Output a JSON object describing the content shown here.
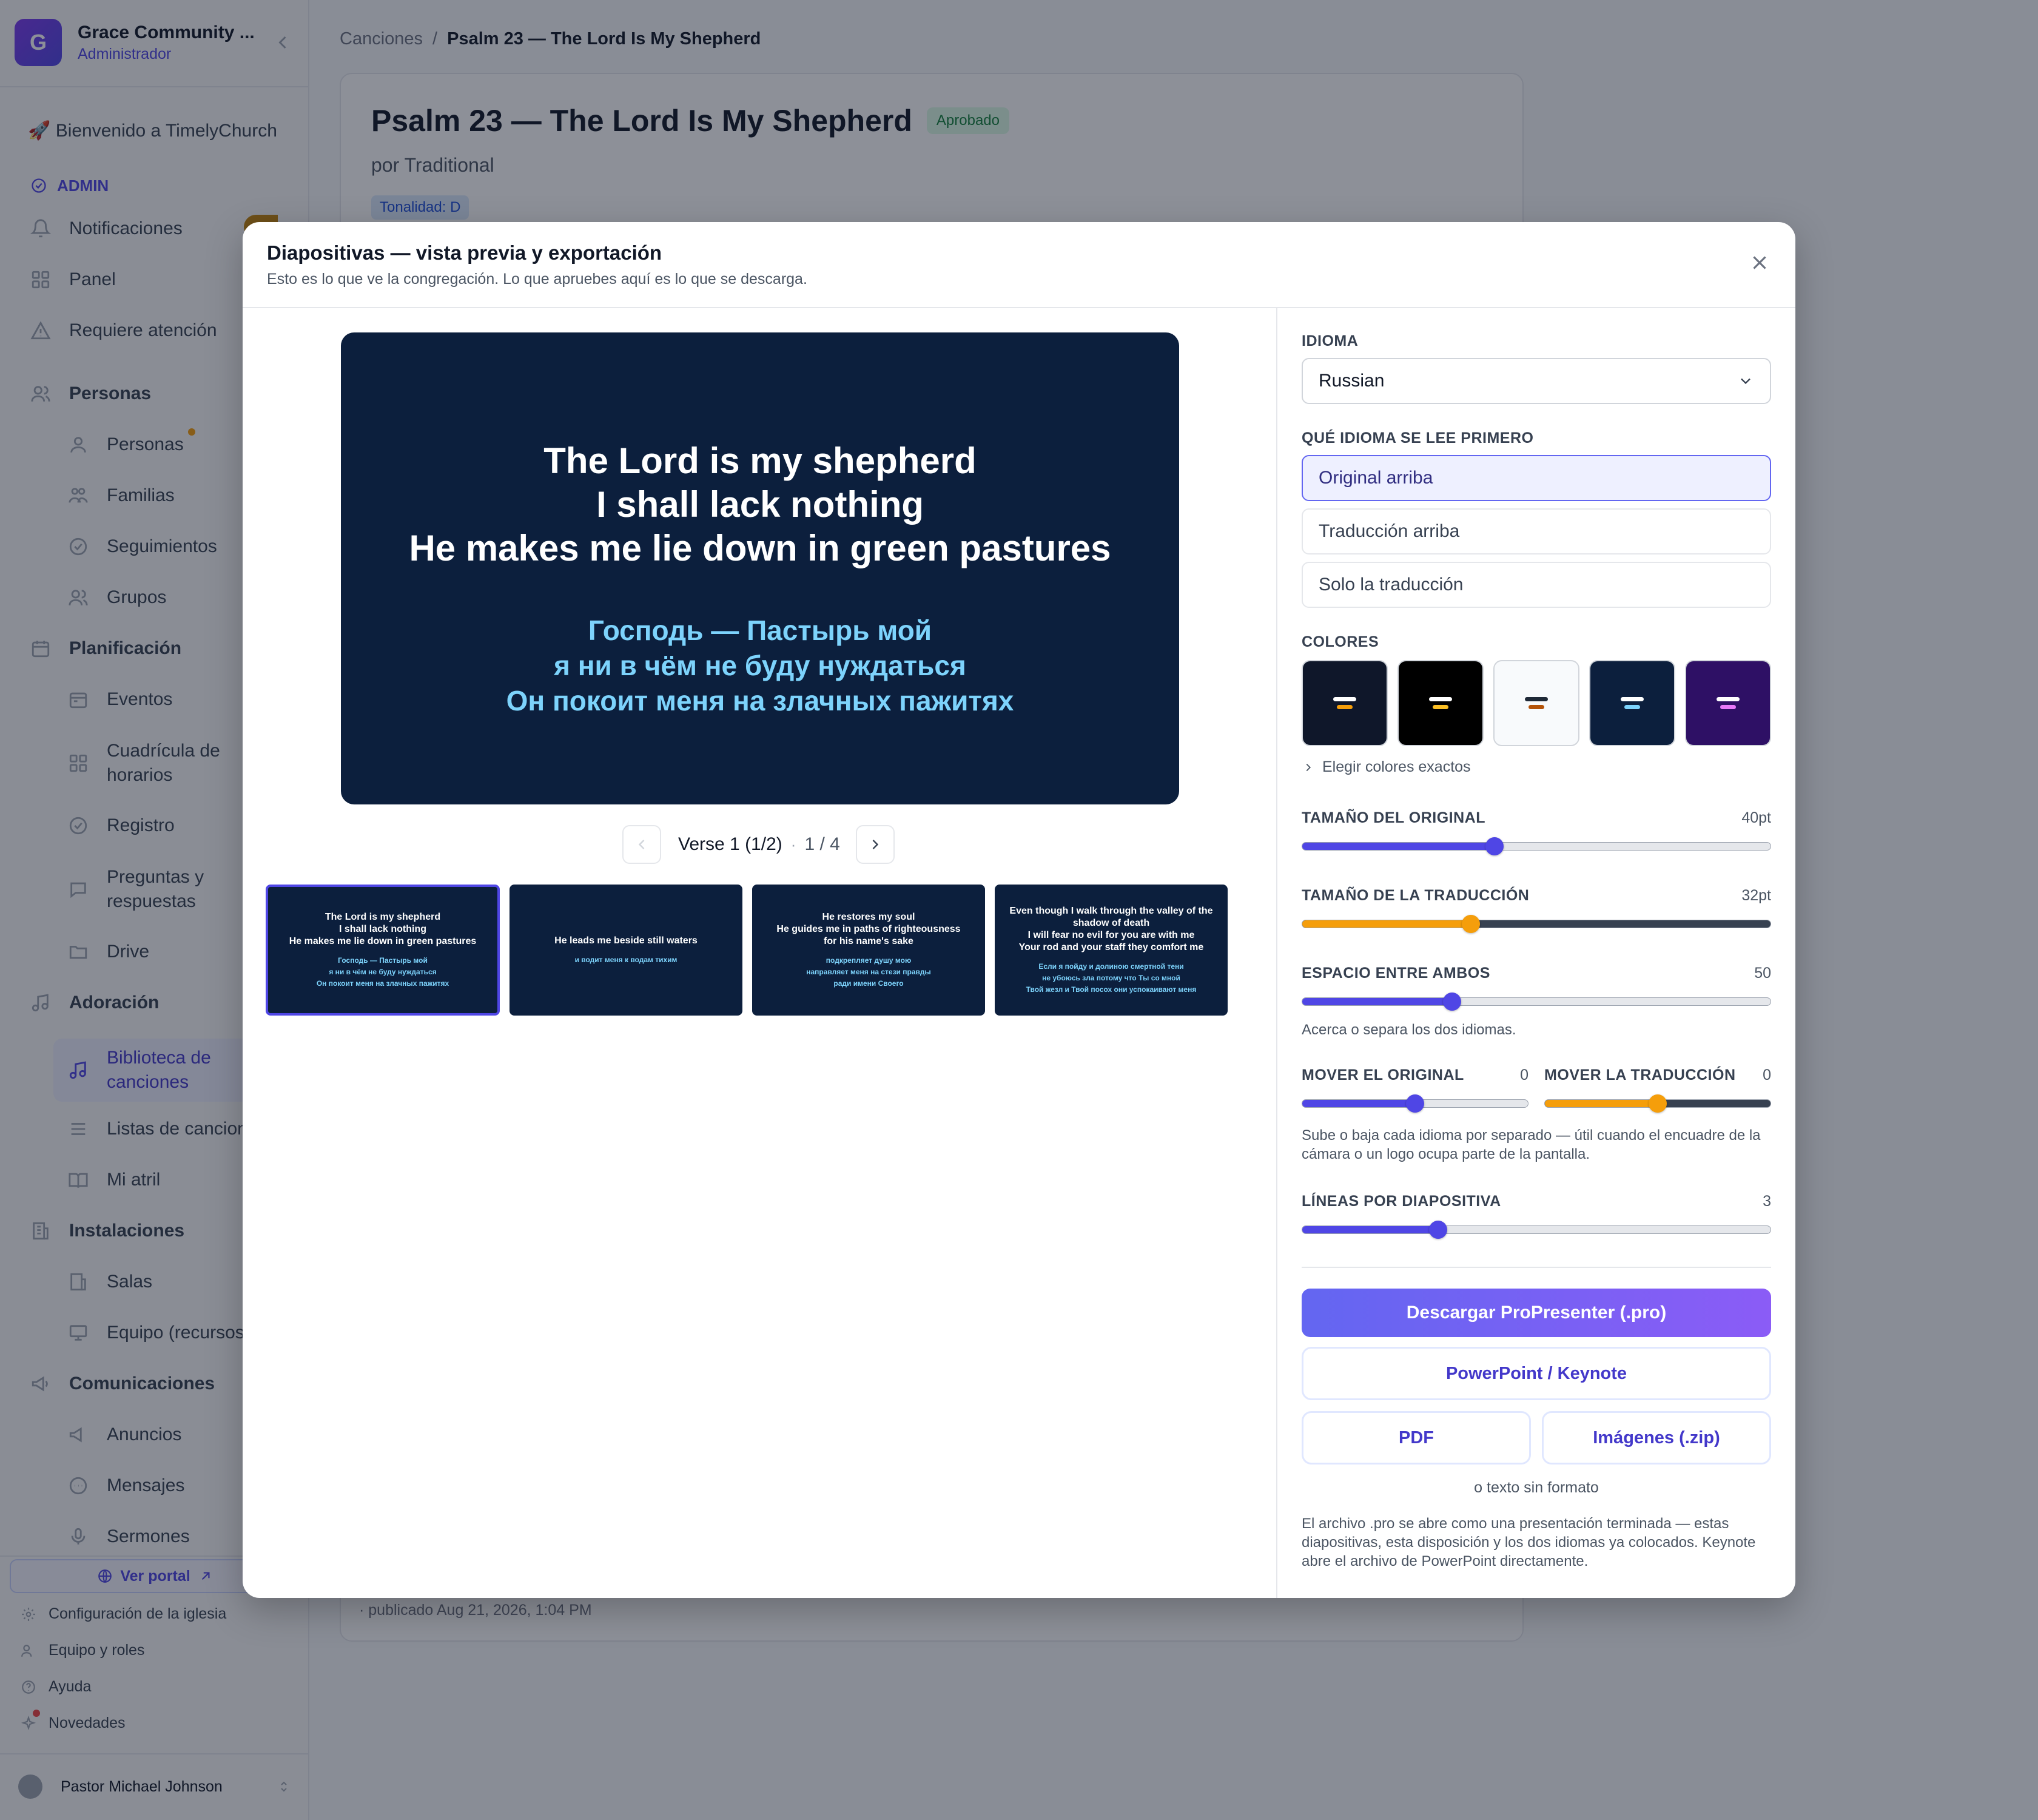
{
  "org": {
    "initial": "G",
    "name": "Grace Community ...",
    "role": "Administrador"
  },
  "sidebar": {
    "welcome": "🚀 Bienvenido a TimelyChurch",
    "admin_label": "ADMIN",
    "items": {
      "notificaciones": "Notificaciones",
      "panel": "Panel",
      "requiere": "Requiere atención",
      "personas_section": "Personas",
      "personas": "Personas",
      "familias": "Familias",
      "seguimientos": "Seguimientos",
      "grupos": "Grupos",
      "planificacion_section": "Planificación",
      "eventos": "Eventos",
      "cuadricula_1": "Cuadrícula de",
      "cuadricula_2": "horarios",
      "registro": "Registro",
      "preguntas_1": "Preguntas y",
      "preguntas_2": "respuestas",
      "drive": "Drive",
      "adoracion_section": "Adoración",
      "biblioteca_1": "Biblioteca de",
      "biblioteca_2": "canciones",
      "listas": "Listas de canciones",
      "atril": "Mi atril",
      "instalaciones_section": "Instalaciones",
      "salas": "Salas",
      "equipo": "Equipo (recursos)",
      "comunicaciones_section": "Comunicaciones",
      "anuncios": "Anuncios",
      "mensajes": "Mensajes",
      "sermones": "Sermones"
    },
    "portal": "Ver portal",
    "footer": {
      "config": "Configuración de la iglesia",
      "team": "Equipo y roles",
      "help": "Ayuda",
      "news": "Novedades"
    },
    "user": "Pastor Michael Johnson"
  },
  "breadcrumb": {
    "parent": "Canciones",
    "current": "Psalm 23 — The Lord Is My Shepherd"
  },
  "song": {
    "title": "Psalm 23 — The Lord Is My Shepherd",
    "status": "Aprobado",
    "author": "por Traditional",
    "key": "Tonalidad: D",
    "published": "· publicado Aug 21, 2026, 1:04 PM"
  },
  "modal": {
    "title": "Diapositivas — vista previa y exportación",
    "subtitle": "Esto es lo que ve la congregación. Lo que apruebes aquí es lo que se descarga.",
    "preview": {
      "original": [
        "The Lord is my shepherd",
        "I shall lack nothing",
        "He makes me lie down in green pastures"
      ],
      "translation": [
        "Господь — Пастырь мой",
        "я ни в чём не буду нуждаться",
        "Он покоит меня на злачных пажитях"
      ]
    },
    "pager": {
      "label": "Verse 1 (1/2)",
      "count": "1 / 4"
    },
    "thumbs": [
      {
        "orig": [
          "The Lord is my shepherd",
          "I shall lack nothing",
          "He makes me lie down in green pastures"
        ],
        "trans": [
          "Господь — Пастырь мой",
          "я ни в чём не буду нуждаться",
          "Он покоит меня на злачных пажитях"
        ]
      },
      {
        "orig": [
          "He leads me beside still waters"
        ],
        "trans": [
          "и водит меня к водам тихим"
        ]
      },
      {
        "orig": [
          "He restores my soul",
          "He guides me in paths of righteousness",
          "for his name's sake"
        ],
        "trans": [
          "подкрепляет душу мою",
          "направляет меня на стези правды",
          "ради имени Своего"
        ]
      },
      {
        "orig": [
          "Even though I walk through the valley of the",
          "shadow of death",
          "I will fear no evil for you are with me",
          "Your rod and your staff they comfort me"
        ],
        "trans": [
          "Если я пойду и долиною смертной тени",
          "не убоюсь зла потому что Ты со мной",
          "Твой жезл и Твой посох они успокаивают меня"
        ]
      }
    ],
    "panel": {
      "language_label": "IDIOMA",
      "language_value": "Russian",
      "order_label": "QUÉ IDIOMA SE LEE PRIMERO",
      "order_options": [
        "Original arriba",
        "Traducción arriba",
        "Solo la traducción"
      ],
      "colors_label": "COLORES",
      "swatches": [
        {
          "bg": "#0f172a",
          "a": "#ffffff",
          "b": "#f59e0b"
        },
        {
          "bg": "#000000",
          "a": "#ffffff",
          "b": "#fbbf24"
        },
        {
          "bg": "#f8fafc",
          "a": "#1f2937",
          "b": "#b45309"
        },
        {
          "bg": "#0c1f3d",
          "a": "#ffffff",
          "b": "#7dd3fc"
        },
        {
          "bg": "#2e1065",
          "a": "#ffffff",
          "b": "#e879f9"
        }
      ],
      "exact_colors": "Elegir colores exactos",
      "size_orig_label": "TAMAÑO DEL ORIGINAL",
      "size_orig_value": "40pt",
      "size_trans_label": "TAMAÑO DE LA TRADUCCIÓN",
      "size_trans_value": "32pt",
      "gap_label": "ESPACIO ENTRE AMBOS",
      "gap_value": "50",
      "gap_help": "Acerca o separa los dos idiomas.",
      "move_orig_label": "MOVER EL ORIGINAL",
      "move_orig_value": "0",
      "move_trans_label": "MOVER LA TRADUCCIÓN",
      "move_trans_value": "0",
      "move_help": "Sube o baja cada idioma por separado — útil cuando el encuadre de la cámara o un logo ocupa parte de la pantalla.",
      "lines_label": "LÍNEAS POR DIAPOSITIVA",
      "lines_value": "3",
      "sliders_level": {
        "size_orig": 0.41,
        "size_trans": 0.36,
        "gap": 0.32,
        "move_orig": 0.5,
        "move_trans": 0.5,
        "lines": 0.29
      },
      "btn_pro": "Descargar ProPresenter (.pro)",
      "btn_ppt": "PowerPoint / Keynote",
      "btn_pdf": "PDF",
      "btn_img": "Imágenes (.zip)",
      "plain_text": "o texto sin formato",
      "note": "El archivo .pro se abre como una presentación terminada — estas diapositivas, esta disposición y los dos idiomas ya colocados. Keynote abre el archivo de PowerPoint directamente."
    }
  },
  "colors": {
    "accent": "#4f46e5",
    "orange": "#f59e0b",
    "slide_bg": "#0c1f3d",
    "slide_trans": "#7dd3fc"
  }
}
